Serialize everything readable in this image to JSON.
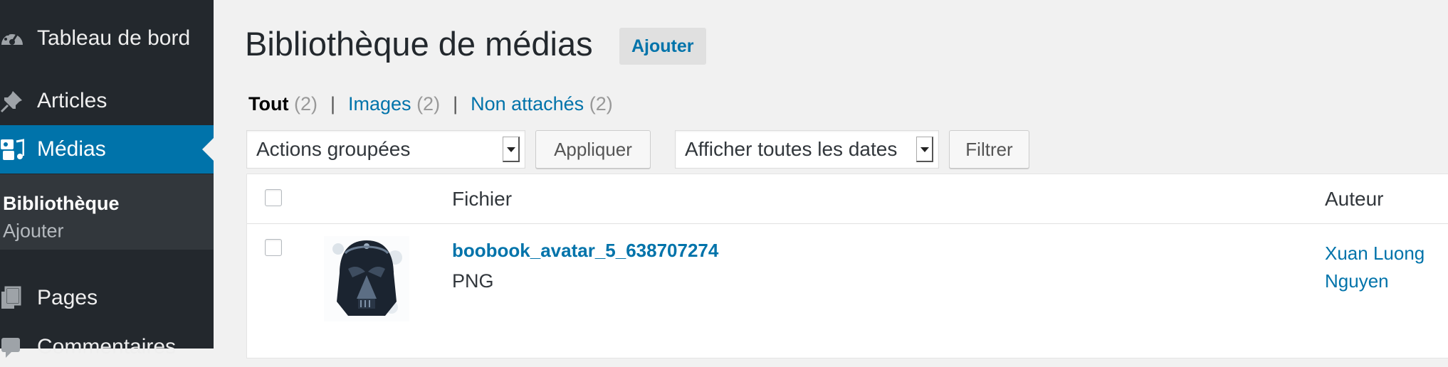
{
  "sidebar": {
    "items": [
      {
        "label": "Tableau de bord",
        "icon": "dashboard-icon"
      },
      {
        "label": "Articles",
        "icon": "pin-icon"
      },
      {
        "label": "Médias",
        "icon": "media-icon"
      },
      {
        "label": "Pages",
        "icon": "pages-icon"
      },
      {
        "label": "Commentaires",
        "icon": "comments-icon"
      }
    ],
    "submenu": [
      {
        "label": "Bibliothèque"
      },
      {
        "label": "Ajouter"
      }
    ]
  },
  "header": {
    "title": "Bibliothèque de médias",
    "add_label": "Ajouter"
  },
  "filters": [
    {
      "label": "Tout",
      "count": "(2)"
    },
    {
      "label": "Images",
      "count": "(2)"
    },
    {
      "label": "Non attachés",
      "count": "(2)"
    }
  ],
  "separator": "|",
  "toolbar": {
    "bulk_actions": "Actions groupées",
    "apply_label": "Appliquer",
    "date_filter": "Afficher toutes les dates",
    "filter_label": "Filtrer"
  },
  "table": {
    "columns": {
      "file": "Fichier",
      "author": "Auteur"
    },
    "rows": [
      {
        "title": "boobook_avatar_5_638707274",
        "type": "PNG",
        "author": "Xuan Luong Nguyen",
        "thumbnail": "darth-vader-helmet-thumbnail"
      }
    ]
  },
  "colors": {
    "sidebar_bg": "#23282d",
    "accent": "#0073aa",
    "submenu_bg": "#32373c",
    "page_bg": "#f1f1f1"
  }
}
